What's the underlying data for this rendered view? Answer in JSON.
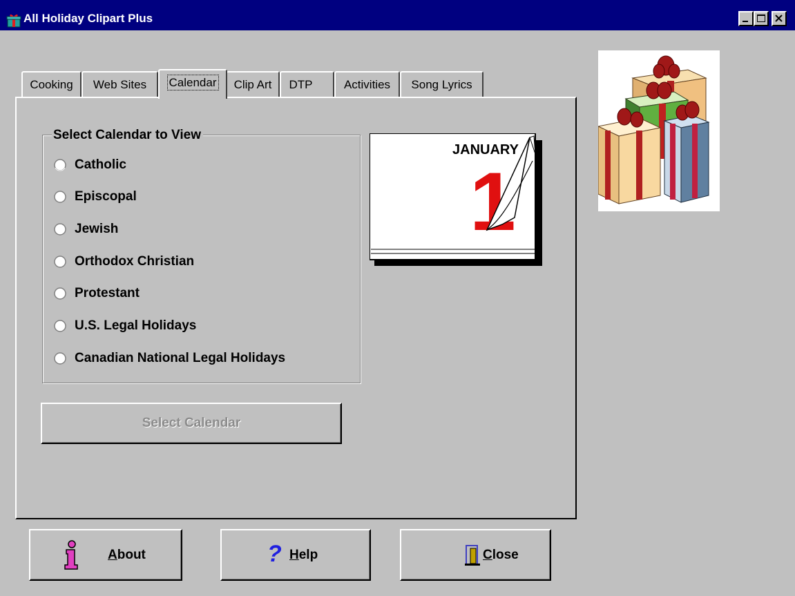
{
  "window": {
    "title": "All Holiday Clipart Plus",
    "app_icon": "gift-icon",
    "controls": [
      "minimize-icon",
      "maximize-icon",
      "close-icon"
    ]
  },
  "tabs": [
    {
      "label": "Cooking",
      "active": false
    },
    {
      "label": "Web Sites",
      "active": false
    },
    {
      "label": "Calendar",
      "active": true
    },
    {
      "label": "Clip Art",
      "active": false
    },
    {
      "label": "DTP",
      "active": false
    },
    {
      "label": "Activities",
      "active": false
    },
    {
      "label": "Song Lyrics",
      "active": false
    }
  ],
  "calendar_panel": {
    "group_label": "Select Calendar to View",
    "options": [
      {
        "label": "Catholic",
        "selected": false
      },
      {
        "label": "Episcopal",
        "selected": false
      },
      {
        "label": "Jewish",
        "selected": false
      },
      {
        "label": "Orthodox Christian",
        "selected": false
      },
      {
        "label": "Protestant",
        "selected": false
      },
      {
        "label": "U.S. Legal Holidays",
        "selected": false
      },
      {
        "label": "Canadian National Legal Holidays",
        "selected": false
      }
    ],
    "select_button": {
      "label": "Select Calendar",
      "enabled": false
    },
    "calendar_image": {
      "month": "JANUARY",
      "day": "1"
    }
  },
  "bottom_buttons": {
    "about": {
      "label_prefix": "",
      "mnemonic": "A",
      "label_rest": "bout",
      "icon": "info-icon"
    },
    "help": {
      "label_prefix": "",
      "mnemonic": "H",
      "label_rest": "elp",
      "icon": "question-mark-icon"
    },
    "close": {
      "label_prefix": "",
      "mnemonic": "C",
      "label_rest": "lose",
      "icon": "exit-door-icon"
    }
  },
  "colors": {
    "titlebar": "#000080",
    "face": "#c0c0c0",
    "disabled_text": "#8c8c8c",
    "calendar_red": "#e01010",
    "info_icon_pink": "#e040c0",
    "help_icon_blue": "#2020e0"
  }
}
